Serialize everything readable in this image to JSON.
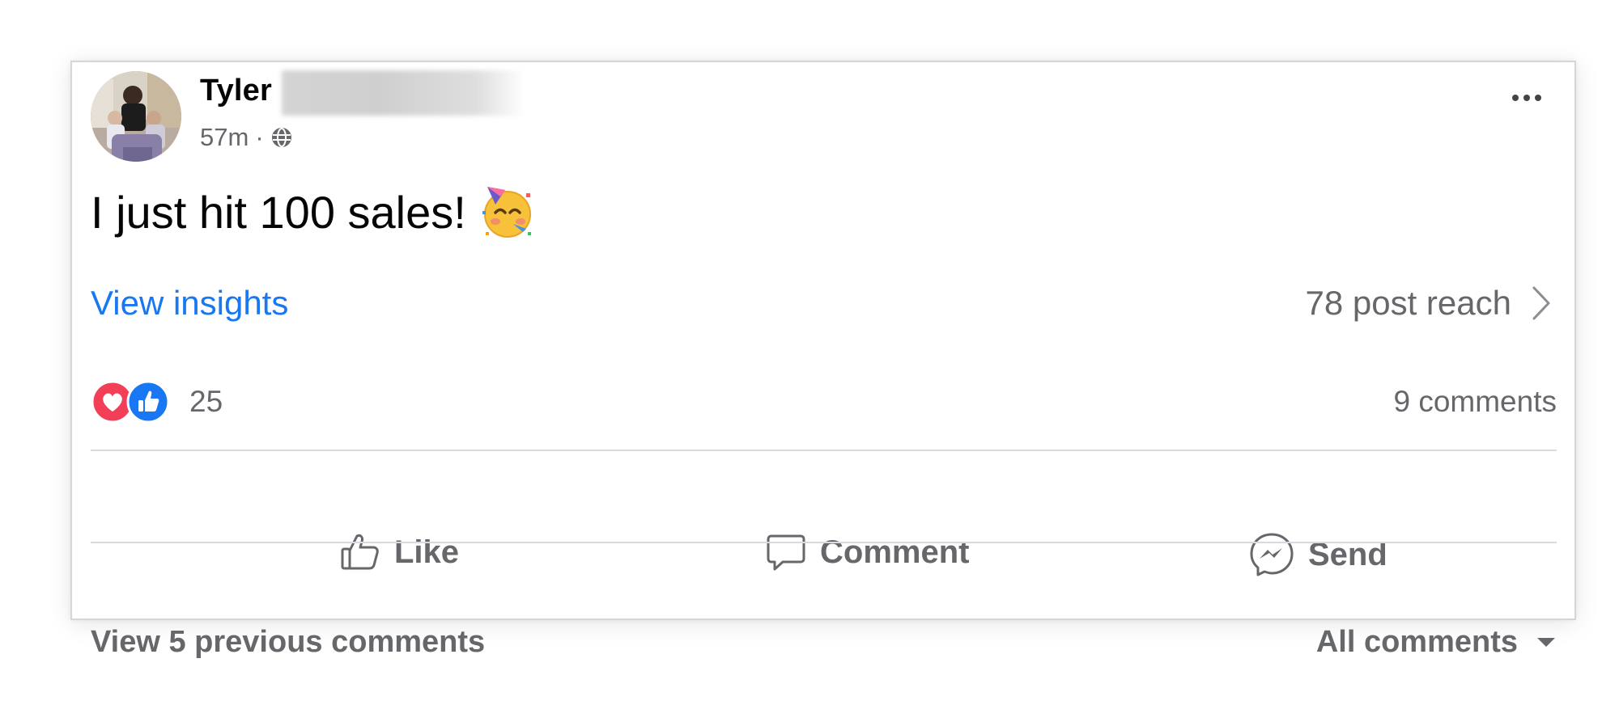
{
  "post": {
    "author_name": "Tyler",
    "time_ago": "57m",
    "meta_separator": "·",
    "audience_icon": "globe-icon",
    "text": "I just hit 100 sales!",
    "emoji_icon": "partying-face-icon",
    "more_icon": "more-horizontal-icon"
  },
  "insights": {
    "link_label": "View insights",
    "reach_label": "78 post reach",
    "reach_icon": "chevron-right-icon"
  },
  "reactions": {
    "count": "25",
    "types": [
      "love",
      "like"
    ],
    "comments_label": "9 comments"
  },
  "actions": {
    "like_label": "Like",
    "comment_label": "Comment",
    "send_label": "Send"
  },
  "comments": {
    "previous_label": "View 5 previous comments",
    "filter_label": "All comments",
    "filter_icon": "caret-down-icon"
  },
  "colors": {
    "link_blue": "#1877f2",
    "like_blue": "#1877f2",
    "love_red": "#f33e58",
    "secondary_text": "#65676b",
    "primary_text": "#050505"
  }
}
